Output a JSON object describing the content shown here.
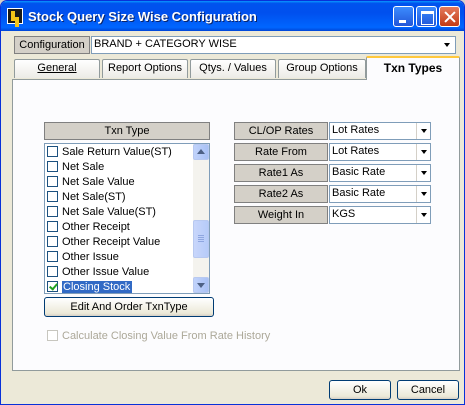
{
  "window": {
    "title": "Stock Query Size Wise Configuration"
  },
  "configuration": {
    "label": "Configuration",
    "value": "BRAND + CATEGORY WISE"
  },
  "tabs": [
    {
      "label": "General"
    },
    {
      "label": "Report Options"
    },
    {
      "label": "Qtys. / Values"
    },
    {
      "label": "Group Options"
    },
    {
      "label": "Txn Types",
      "active": true
    }
  ],
  "txn_type": {
    "header": "Txn Type",
    "items": [
      {
        "label": "Sale Return Value(ST)",
        "checked": false
      },
      {
        "label": "Net Sale",
        "checked": false
      },
      {
        "label": "Net Sale Value",
        "checked": false
      },
      {
        "label": "Net Sale(ST)",
        "checked": false
      },
      {
        "label": "Net Sale Value(ST)",
        "checked": false
      },
      {
        "label": "Other Receipt",
        "checked": false
      },
      {
        "label": "Other Receipt Value",
        "checked": false
      },
      {
        "label": "Other Issue",
        "checked": false
      },
      {
        "label": "Other Issue Value",
        "checked": false
      },
      {
        "label": "Closing Stock",
        "checked": true,
        "selected": true
      }
    ]
  },
  "edit_order_button": "Edit And Order TxnType",
  "closing_value_checkbox": {
    "label": "Calculate Closing Value From Rate History",
    "checked": false,
    "enabled": false
  },
  "properties": [
    {
      "label": "CL/OP Rates",
      "value": "Lot Rates"
    },
    {
      "label": "Rate From",
      "value": "Lot Rates"
    },
    {
      "label": "Rate1 As",
      "value": "Basic Rate"
    },
    {
      "label": "Rate2 As",
      "value": "Basic Rate"
    },
    {
      "label": "Weight In",
      "value": "KGS"
    }
  ],
  "ok_button": "Ok",
  "cancel_button": "Cancel"
}
